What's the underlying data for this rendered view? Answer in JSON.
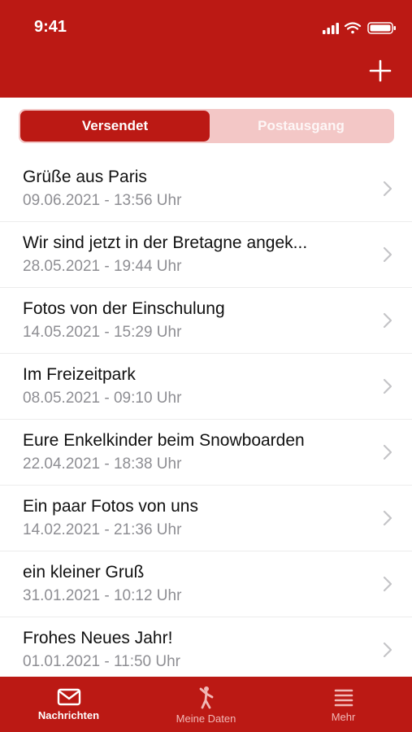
{
  "status_bar": {
    "time": "9:41"
  },
  "colors": {
    "brand": "#BB1914",
    "segment_inactive_bg": "#F3C7C6",
    "date_text": "#8E8E93"
  },
  "header": {
    "add_icon": "plus-icon"
  },
  "segments": [
    {
      "label": "Versendet",
      "selected": true
    },
    {
      "label": "Postausgang",
      "selected": false
    }
  ],
  "messages": [
    {
      "title": "Grüße aus Paris",
      "date": "09.06.2021 - 13:56 Uhr"
    },
    {
      "title": "Wir sind jetzt in der Bretagne angek...",
      "date": "28.05.2021 - 19:44 Uhr"
    },
    {
      "title": "Fotos von der Einschulung",
      "date": "14.05.2021 - 15:29 Uhr"
    },
    {
      "title": "Im Freizeitpark",
      "date": "08.05.2021 - 09:10 Uhr"
    },
    {
      "title": "Eure Enkelkinder beim Snowboarden",
      "date": "22.04.2021 - 18:38 Uhr"
    },
    {
      "title": "Ein paar Fotos von uns",
      "date": "14.02.2021 - 21:36 Uhr"
    },
    {
      "title": "ein kleiner Gruß",
      "date": "31.01.2021 - 10:12 Uhr"
    },
    {
      "title": "Frohes Neues Jahr!",
      "date": "01.01.2021 - 11:50 Uhr"
    }
  ],
  "tabbar": [
    {
      "label": "Nachrichten",
      "icon": "envelope-icon",
      "active": true
    },
    {
      "label": "Meine Daten",
      "icon": "person-icon",
      "active": false
    },
    {
      "label": "Mehr",
      "icon": "menu-icon",
      "active": false
    }
  ]
}
